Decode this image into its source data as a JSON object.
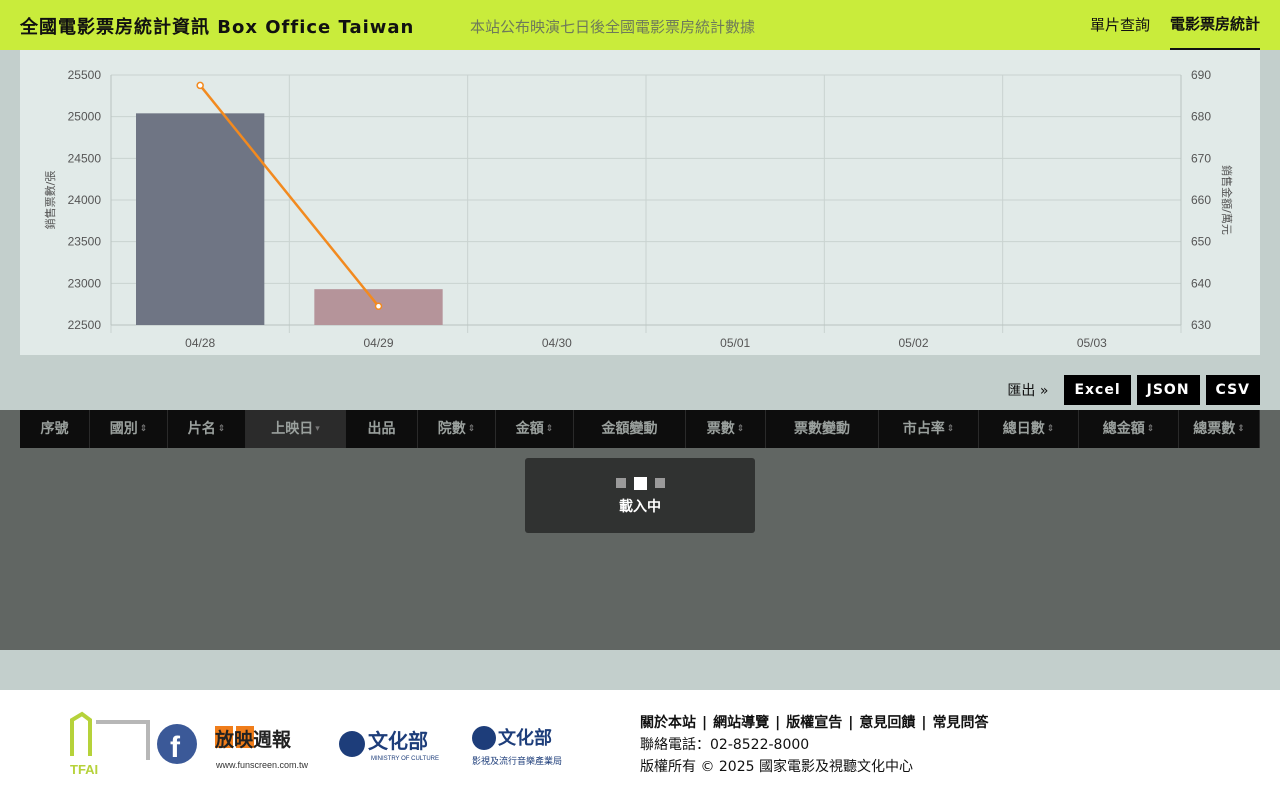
{
  "header": {
    "title": "全國電影票房統計資訊 Box Office Taiwan",
    "tagline": "本站公布映演七日後全國電影票房統計數據",
    "nav": [
      {
        "label": "單片查詢",
        "active": false
      },
      {
        "label": "電影票房統計",
        "active": true
      }
    ]
  },
  "chart_data": {
    "type": "bar",
    "categories": [
      "04/28",
      "04/29",
      "04/30",
      "05/01",
      "05/02",
      "05/03"
    ],
    "ylabel": "銷售票數/張",
    "y2label": "銷售金額/萬元",
    "ylim": [
      22500,
      25500
    ],
    "y2lim": [
      630,
      690
    ],
    "yticks": [
      22500,
      23000,
      23500,
      24000,
      24500,
      25000,
      25500
    ],
    "y2ticks": [
      630,
      640,
      650,
      660,
      670,
      680,
      690
    ],
    "series": [
      {
        "kind": "bar",
        "axis": "left",
        "values": [
          25040,
          22930,
          null,
          null,
          null,
          null
        ],
        "colors": [
          "#6f7584",
          "#b5949a"
        ]
      },
      {
        "kind": "line",
        "axis": "right",
        "values": [
          687.5,
          634.5,
          null,
          null,
          null,
          null
        ],
        "color": "#f28a1f"
      }
    ],
    "grid": true,
    "colors": {
      "panel": "#e1eae8",
      "grid": "#c9d3d0",
      "axis": "#b9c3c0",
      "tick_text": "#555"
    }
  },
  "export": {
    "label": "匯出 »",
    "buttons": [
      "Excel",
      "JSON",
      "CSV"
    ]
  },
  "table": {
    "columns": [
      {
        "label": "序號",
        "sortable": false
      },
      {
        "label": "國別",
        "sortable": true
      },
      {
        "label": "片名",
        "sortable": true
      },
      {
        "label": "上映日",
        "sortable": true,
        "sorted": true
      },
      {
        "label": "出品",
        "sortable": false
      },
      {
        "label": "院數",
        "sortable": true
      },
      {
        "label": "金額",
        "sortable": true
      },
      {
        "label": "金額變動",
        "sortable": false
      },
      {
        "label": "票數",
        "sortable": true
      },
      {
        "label": "票數變動",
        "sortable": false
      },
      {
        "label": "市占率",
        "sortable": true
      },
      {
        "label": "總日數",
        "sortable": true
      },
      {
        "label": "總金額",
        "sortable": true
      },
      {
        "label": "總票數",
        "sortable": true
      }
    ],
    "loading_text": "載入中"
  },
  "footer": {
    "links": [
      "關於本站",
      "網站導覽",
      "版權宣告",
      "意見回饋",
      "常見問答"
    ],
    "phone": "聯絡電話：02-8522-8000",
    "copyright": "版權所有 © 2025 國家電影及視聽文化中心",
    "logos": {
      "tfai": "TFAI",
      "facebook_icon": "facebook-icon",
      "funscreen": "放映週報",
      "funscreen_sub": "www.funscreen.com.tw",
      "moc": "文化部",
      "moc_sub": "MINISTRY OF CULTURE",
      "moc2": "文化部",
      "moc2_sub": "影視及流行音樂產業局"
    }
  }
}
